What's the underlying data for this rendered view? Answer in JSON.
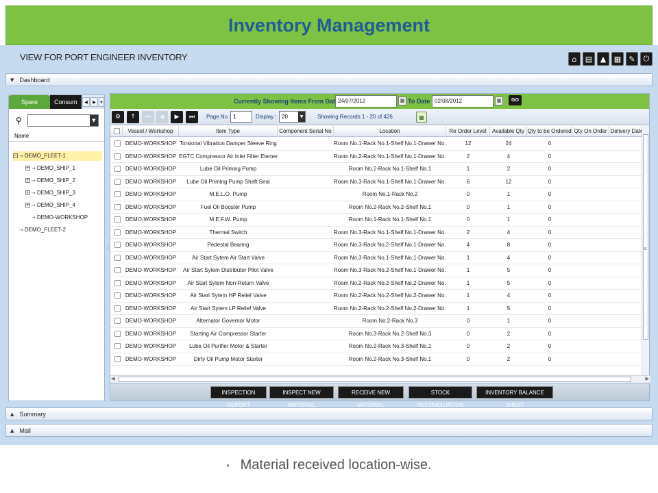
{
  "title": "Inventory Management",
  "subtitle": "VIEW FOR PORT ENGINEER INVENTORY",
  "top_icons": [
    "home-icon",
    "printer-icon",
    "alert-icon",
    "document-icon",
    "pencil-icon",
    "power-icon"
  ],
  "panels": {
    "dashboard": "Dashboard",
    "summary": "Summary",
    "mail": "Mail"
  },
  "left": {
    "tabs": [
      "Spare",
      "Consum"
    ],
    "name_header": "Name",
    "tree": [
      {
        "label": "DEMO_FLEET-1",
        "level": 0,
        "expanded": true,
        "selected": true
      },
      {
        "label": "DEMO_SHIP_1",
        "level": 1,
        "expandable": true
      },
      {
        "label": "DEMO_SHIP_2",
        "level": 1,
        "expandable": true
      },
      {
        "label": "DEMO_SHIP_3",
        "level": 1,
        "expandable": true
      },
      {
        "label": "DEMO_SHIP_4",
        "level": 1,
        "expandable": true
      },
      {
        "label": "DEMO-WORKSHOP",
        "level": 1,
        "expandable": false
      },
      {
        "label": "DEMO_FLEET-2",
        "level": 0,
        "expandable": false
      }
    ]
  },
  "datebar": {
    "from_label": "Currently Showing Items From Date :",
    "from_value": "24/07/2012",
    "to_label": "To Date :",
    "to_value": "02/08/2012",
    "go": "GO"
  },
  "toolbar": {
    "page_label": "Page No :",
    "page_value": "1",
    "display_label": "Display :",
    "display_value": "20",
    "records": "Showing Records 1 - 20 of 426"
  },
  "columns": [
    "Vessel / Workshop",
    "Item Type",
    "Component Serial No",
    "Location",
    "Re Order Level",
    "Available Qty",
    "Qty to be Ordered",
    "Qty On Order",
    "Delivery Date"
  ],
  "rows": [
    [
      "DEMO-WORKSHOP",
      "Torsional Vibration Damper Sleeve Ring",
      "",
      "Room No.1-Rack No.1-Shelf No.1-Drawer No.1",
      "12",
      "24",
      "0"
    ],
    [
      "DEMO-WORKSHOP",
      "EGTC Compressor Air Inlet Filter Elements",
      "",
      "Room No.2-Rack No.1-Shelf No.1-Drawer No.1",
      "2",
      "4",
      "0"
    ],
    [
      "DEMO-WORKSHOP",
      "Lube Oil Priming Pump",
      "",
      "Room No.2-Rack No.1-Shelf No.1",
      "1",
      "2",
      "0"
    ],
    [
      "DEMO-WORKSHOP",
      "Lube Oil Priming Pump Shaft Seal",
      "",
      "Room No.3-Rack No.1-Shelf No.1-Drawer No.1",
      "6",
      "12",
      "0"
    ],
    [
      "DEMO-WORKSHOP",
      "M.E.L.O. Pump",
      "",
      "Room No.1-Rack No.2",
      "0",
      "1",
      "0"
    ],
    [
      "DEMO-WORKSHOP",
      "Fuel Oil Booster Pump",
      "",
      "Room No.2-Rack No.2-Shelf No.1",
      "0",
      "1",
      "0"
    ],
    [
      "DEMO-WORKSHOP",
      "M.E.F.W. Pump",
      "",
      "Room No.1-Rack No.1-Shelf No.1",
      "0",
      "1",
      "0"
    ],
    [
      "DEMO-WORKSHOP",
      "Thermal Switch",
      "",
      "Room No.3-Rack No.1-Shelf No.1-Drawer No.2",
      "2",
      "4",
      "0"
    ],
    [
      "DEMO-WORKSHOP",
      "Pedestal Bearing",
      "",
      "Room No.3-Rack No.2-Shelf No.1-Drawer No.1",
      "4",
      "8",
      "0"
    ],
    [
      "DEMO-WORKSHOP",
      "Air Start Sytem Air Start Valve",
      "",
      "Room No.3-Rack No.1-Shelf No.1-Drawer No.1",
      "1",
      "4",
      "0"
    ],
    [
      "DEMO-WORKSHOP",
      "Air Start Sytem Distributor Pilot Valve",
      "",
      "Room No.3-Rack No.2-Shelf No.1-Drawer No.2",
      "1",
      "5",
      "0"
    ],
    [
      "DEMO-WORKSHOP",
      "Air Start Sytem Non-Return Valve",
      "",
      "Room No.2-Rack No.2-Shelf No.2-Drawer No.1",
      "1",
      "5",
      "0"
    ],
    [
      "DEMO-WORKSHOP",
      "Air Start Sytem HP Relief Valve",
      "",
      "Room No.2-Rack No.2-Shelf No.2-Drawer No.2",
      "1",
      "4",
      "0"
    ],
    [
      "DEMO-WORKSHOP",
      "Air Start Sytem LP Relief Valve",
      "",
      "Room No.2-Rack No.2-Shelf No.2-Drawer No.3",
      "1",
      "5",
      "0"
    ],
    [
      "DEMO-WORKSHOP",
      "Alternator Governor Motor",
      "",
      "Room No.2-Rack No.3",
      "0",
      "1",
      "0"
    ],
    [
      "DEMO-WORKSHOP",
      "Starting Air Compressor Starter",
      "",
      "Room No.3-Rack No.2-Shelf No.3",
      "0",
      "2",
      "0"
    ],
    [
      "DEMO-WORKSHOP",
      "Lube Oil Purifier Motor & Starter",
      "",
      "Room No.2-Rack No.3-Shelf No.1",
      "0",
      "2",
      "0"
    ],
    [
      "DEMO-WORKSHOP",
      "Dirty Oil Pump Motor Starter",
      "",
      "Room No.2-Rack No.3-Shelf No.1",
      "0",
      "2",
      "0"
    ]
  ],
  "actions": [
    "INSPECTION REPORT",
    "INSPECT NEW MATERIAL",
    "RECEIVE NEW MATERIAL",
    "STOCK RECONCILIATION",
    "INVENTORY BALANCE SHEET"
  ],
  "caption": "Material received location-wise.",
  "colors": {
    "green": "#7dc242",
    "title_blue": "#1f5c99",
    "app_bg": "#c7dbf0"
  }
}
